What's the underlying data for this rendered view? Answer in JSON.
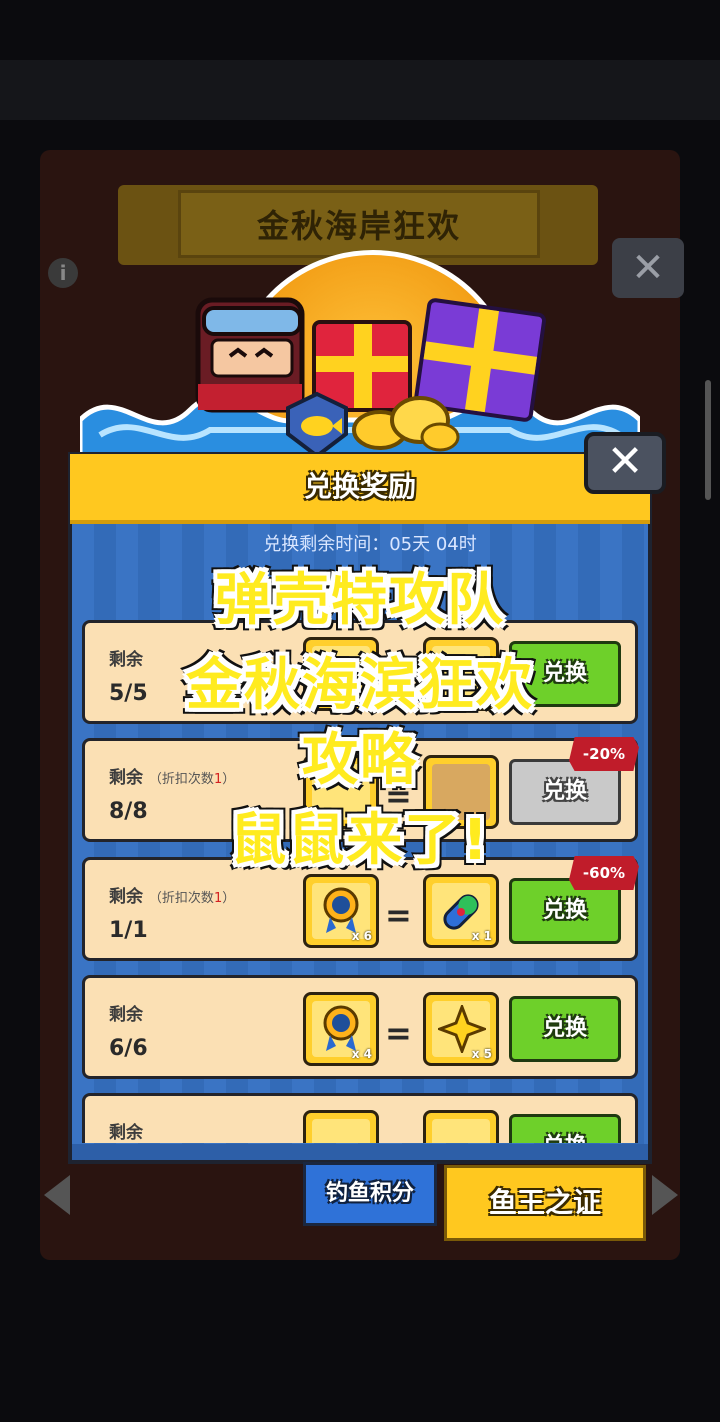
{
  "background": {
    "event_title": "金秋海岸狂欢",
    "info_icon": "i",
    "close_icon": "✕"
  },
  "modal": {
    "title": "兑换奖励",
    "timer_text": "兑换剩余时间：05天 04时",
    "close_icon": "✕"
  },
  "rows": [
    {
      "label": "剩余",
      "sub": "",
      "count": "5/5",
      "cost_qty": "",
      "reward_qty": "",
      "button": "兑换",
      "discount": ""
    },
    {
      "label": "剩余",
      "sub": "（折扣次数",
      "sub_red": "1",
      "sub_end": "）",
      "count": "8/8",
      "cost_qty": "",
      "reward_qty": "",
      "button": "兑换",
      "discount": "-20%"
    },
    {
      "label": "剩余",
      "sub": "（折扣次数",
      "sub_red": "1",
      "sub_end": "）",
      "count": "1/1",
      "cost_qty": "x 6",
      "reward_qty": "x 1",
      "button": "兑换",
      "discount": "-60%"
    },
    {
      "label": "剩余",
      "sub": "",
      "count": "6/6",
      "cost_qty": "x 4",
      "reward_qty": "x 5",
      "button": "兑换",
      "discount": ""
    },
    {
      "label": "剩余",
      "sub": "",
      "count": "",
      "cost_qty": "",
      "reward_qty": "",
      "button": "兑换",
      "discount": ""
    }
  ],
  "tabs": {
    "fishing_points": "钓鱼积分",
    "fish_king": "鱼王之证"
  },
  "caption": {
    "line1": "弹壳特攻队",
    "line2": "金秋海滨狂欢",
    "line3": "攻略",
    "line4": "鼠鼠来了!"
  },
  "colors": {
    "accent_yellow": "#ffc81f",
    "button_green": "#6ed02a",
    "panel_blue": "#2d5fa8",
    "discount_red": "#c01c2a"
  }
}
